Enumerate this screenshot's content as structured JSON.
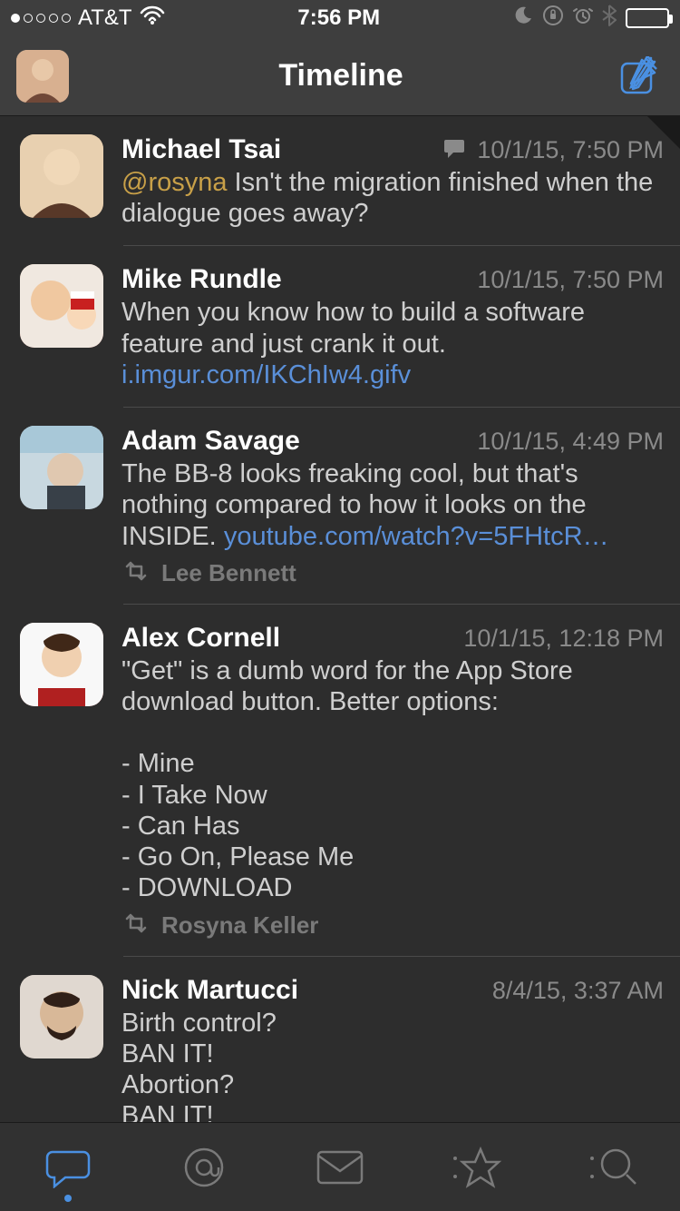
{
  "status_bar": {
    "carrier": "AT&T",
    "time": "7:56 PM",
    "signal_filled": 1,
    "signal_total": 5
  },
  "header": {
    "title": "Timeline"
  },
  "tweets": [
    {
      "name": "Michael Tsai",
      "timestamp": "10/1/15, 7:50 PM",
      "has_reply_indicator": true,
      "mention": "@rosyna",
      "text_after_mention": " Isn't the migration finished when the dialogue goes away?",
      "link": "",
      "retweeted_by": "",
      "has_corner_fold": true
    },
    {
      "name": "Mike Rundle",
      "timestamp": "10/1/15, 7:50 PM",
      "has_reply_indicator": false,
      "mention": "",
      "text_before_link": "When you know how to build a software feature and just crank it out. ",
      "link": "i.imgur.com/IKChIw4.gifv",
      "retweeted_by": ""
    },
    {
      "name": "Adam Savage",
      "timestamp": "10/1/15, 4:49 PM",
      "has_reply_indicator": false,
      "mention": "",
      "text_before_link": "The BB-8 looks freaking cool, but that's nothing compared to how it looks on the INSIDE. ",
      "link": "youtube.com/watch?v=5FHtcR…",
      "retweeted_by": "Lee Bennett"
    },
    {
      "name": "Alex Cornell",
      "timestamp": "10/1/15, 12:18 PM",
      "has_reply_indicator": false,
      "mention": "",
      "text_full": "\"Get\" is a dumb word for the App Store download button. Better options:\n\n- Mine\n- I Take Now\n- Can Has\n- Go On, Please Me\n- DOWNLOAD",
      "link": "",
      "retweeted_by": "Rosyna Keller"
    },
    {
      "name": "Nick Martucci",
      "timestamp": "8/4/15, 3:37 AM",
      "has_reply_indicator": false,
      "mention": "",
      "text_full": "Birth control?\nBAN IT!\nAbortion?\nBAN IT!\nGay marriage?\nBAN IT!",
      "link": "",
      "retweeted_by": ""
    }
  ],
  "tabs": {
    "active_index": 0
  }
}
